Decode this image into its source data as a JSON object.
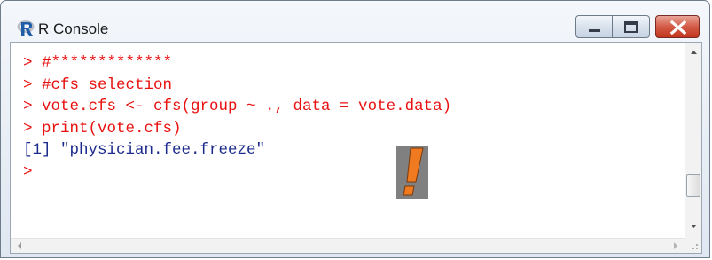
{
  "window": {
    "title": "R Console",
    "app_icon": "r-logo-icon",
    "controls": [
      "minimize-icon",
      "maximize-icon",
      "close-icon"
    ]
  },
  "console": {
    "lines": [
      {
        "text": "> #*************",
        "kind": "command"
      },
      {
        "text": "> #cfs selection",
        "kind": "command"
      },
      {
        "text": "> vote.cfs <- cfs(group ~ ., data = vote.data)",
        "kind": "command"
      },
      {
        "text": "> print(vote.cfs)",
        "kind": "command"
      },
      {
        "text": "[1] \"physician.fee.freeze\"",
        "kind": "output"
      },
      {
        "text": ">",
        "kind": "command"
      }
    ],
    "colors": {
      "command": "#e8110f",
      "output": "#1b2a8c"
    }
  },
  "overlay": {
    "icon": "exclamation-icon",
    "color": "#f07a20"
  }
}
